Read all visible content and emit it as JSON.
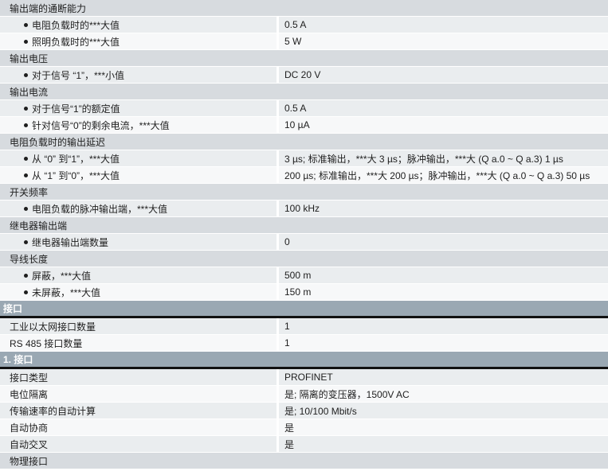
{
  "rows": [
    {
      "type": "sub",
      "label": "输出端的通断能力"
    },
    {
      "type": "bullet",
      "label": "电阻负载时的***大值",
      "value": "0.5 A"
    },
    {
      "type": "bullet",
      "label": "照明负载时的***大值",
      "value": "5 W"
    },
    {
      "type": "sub",
      "label": "输出电压"
    },
    {
      "type": "bullet",
      "label": "对于信号 “1”，***小值",
      "value": "DC 20 V"
    },
    {
      "type": "sub",
      "label": "输出电流"
    },
    {
      "type": "bullet",
      "label": "对于信号“1”的额定值",
      "value": "0.5 A"
    },
    {
      "type": "bullet",
      "label": "针对信号“0”的剩余电流，***大值",
      "value": "10 µA"
    },
    {
      "type": "sub",
      "label": "电阻负载时的输出延迟"
    },
    {
      "type": "bullet",
      "label": "从 “0” 到“1”，***大值",
      "value": "3 µs; 标准输出，***大 3 µs；脉冲输出，***大 (Q a.0 ~ Q a.3) 1 µs"
    },
    {
      "type": "bullet",
      "label": "从 “1” 到“0”，***大值",
      "value": "200 µs; 标准输出，***大 200 µs；脉冲输出，***大 (Q a.0 ~ Q a.3) 50 µs"
    },
    {
      "type": "sub",
      "label": "开关频率"
    },
    {
      "type": "bullet",
      "label": "电阻负载的脉冲输出端，***大值",
      "value": "100 kHz"
    },
    {
      "type": "sub",
      "label": "继电器输出端"
    },
    {
      "type": "bullet",
      "label": "继电器输出端数量",
      "value": "0"
    },
    {
      "type": "sub",
      "label": "导线长度"
    },
    {
      "type": "bullet",
      "label": "屏蔽，***大值",
      "value": "500 m"
    },
    {
      "type": "bullet",
      "label": "未屏蔽，***大值",
      "value": "150 m"
    },
    {
      "type": "section",
      "label": "接口"
    },
    {
      "type": "item",
      "label": "工业以太网接口数量",
      "value": "1"
    },
    {
      "type": "item",
      "label": "RS 485 接口数量",
      "value": "1"
    },
    {
      "type": "section",
      "label": "1. 接口"
    },
    {
      "type": "item",
      "label": "接口类型",
      "value": "PROFINET"
    },
    {
      "type": "item",
      "label": "电位隔离",
      "value": "是; 隔离的变压器，1500V AC"
    },
    {
      "type": "item",
      "label": "传输速率的自动计算",
      "value": "是; 10/100 Mbit/s"
    },
    {
      "type": "item",
      "label": "自动协商",
      "value": "是"
    },
    {
      "type": "item",
      "label": "自动交叉",
      "value": "是"
    },
    {
      "type": "sub",
      "label": "物理接口"
    }
  ]
}
